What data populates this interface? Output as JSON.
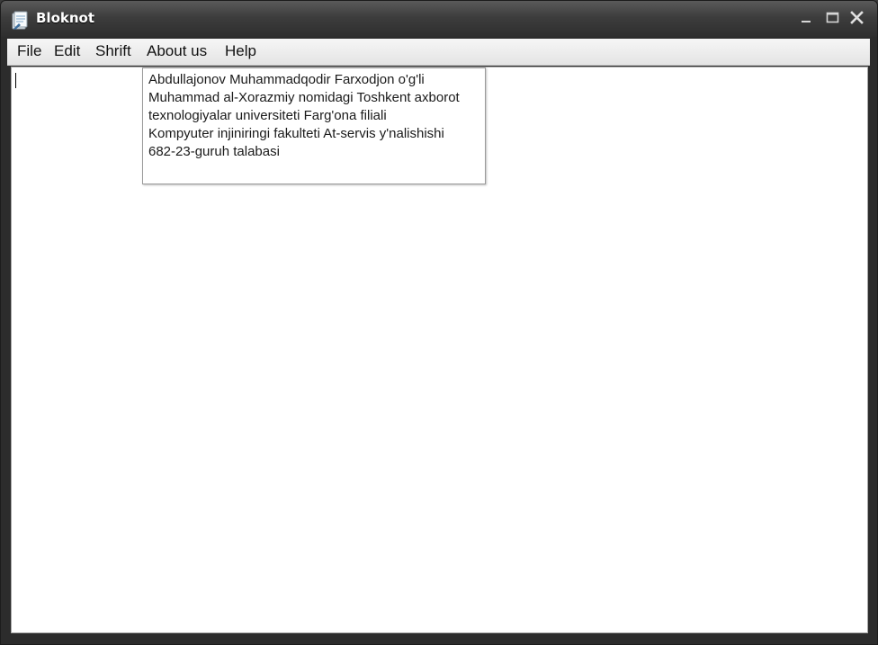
{
  "window": {
    "title": "Bloknot",
    "icon": "notepad-icon",
    "controls": {
      "minimize_icon": "minimize-icon",
      "maximize_icon": "maximize-icon",
      "close_icon": "close-icon"
    }
  },
  "menu": {
    "items": [
      {
        "label": "File"
      },
      {
        "label": "Edit"
      },
      {
        "label": "Shrift"
      },
      {
        "label": "About us"
      },
      {
        "label": "Help"
      }
    ]
  },
  "editor": {
    "text": ""
  },
  "tooltip": {
    "lines": [
      "Abdullajonov Muhammadqodir Farxodjon o'g'li",
      "Muhammad al-Xorazmiy nomidagi Toshkent axborot",
      "texnologiyalar universiteti Farg'ona filiali",
      "Kompyuter injiniringi fakulteti At-servis y'nalishishi",
      "682-23-guruh talabasi"
    ]
  },
  "colors": {
    "titlebar": "#2e2e2e",
    "menubar": "#ececec",
    "editor_bg": "#ffffff"
  }
}
